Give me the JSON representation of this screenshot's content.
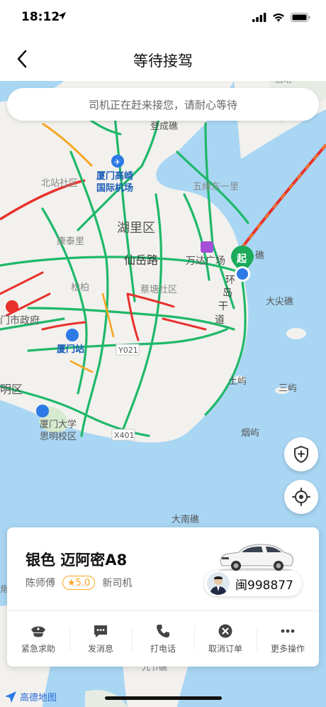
{
  "status_bar": {
    "time": "18:12"
  },
  "nav": {
    "title": "等待接驾"
  },
  "notice": {
    "text": "司机正在赶来接您，请耐心等待"
  },
  "map": {
    "labels": {
      "top_partial": "后塔",
      "dengcheng": "登成礁",
      "airport1": "厦门高崎",
      "airport2": "国际机场",
      "beizhan": "北站社区",
      "wuyuan": "五缘东一里",
      "huli": "湖里区",
      "kangtai": "康泰里",
      "xianyue": "仙岳路",
      "wanda": "万达广场",
      "songbai": "松柏",
      "caitang": "蔡塘社区",
      "huandao1": "环",
      "huandao2": "岛",
      "huandao3": "干",
      "huandao4": "道",
      "rightjiao": "礁",
      "dajian": "大尖礁",
      "shizhengfu": "门市政府",
      "xiamenzhan": "厦门站",
      "y021": "Y021",
      "mingqu": "明区",
      "xmu1": "厦门大学",
      "xmu2": "思明校区",
      "x401": "X401",
      "tuyu": "土屿",
      "sanyu": "三屿",
      "yanyu": "烟屿",
      "dananjiao": "大南礁",
      "jiuxiajiao": "九节礁",
      "leftedge": "角",
      "origin_tag": "起"
    },
    "attribution": "高德地图"
  },
  "card": {
    "car_model": "银色 迈阿密A8",
    "driver_name": "陈师傅",
    "rating": "★5.0",
    "driver_tag": "新司机",
    "plate": "闽998877"
  },
  "actions": [
    {
      "label": "紧急求助",
      "icon": "police-hat-icon"
    },
    {
      "label": "发消息",
      "icon": "message-icon"
    },
    {
      "label": "打电话",
      "icon": "phone-icon"
    },
    {
      "label": "取消订单",
      "icon": "cancel-icon"
    },
    {
      "label": "更多操作",
      "icon": "more-icon"
    }
  ],
  "colors": {
    "water": "#a9d6f3",
    "land": "#f2f1ee",
    "road_green": "#1fb86a",
    "road_red": "#e8312c",
    "road_yellow": "#f5a623",
    "accent_orange": "#f5a623"
  }
}
